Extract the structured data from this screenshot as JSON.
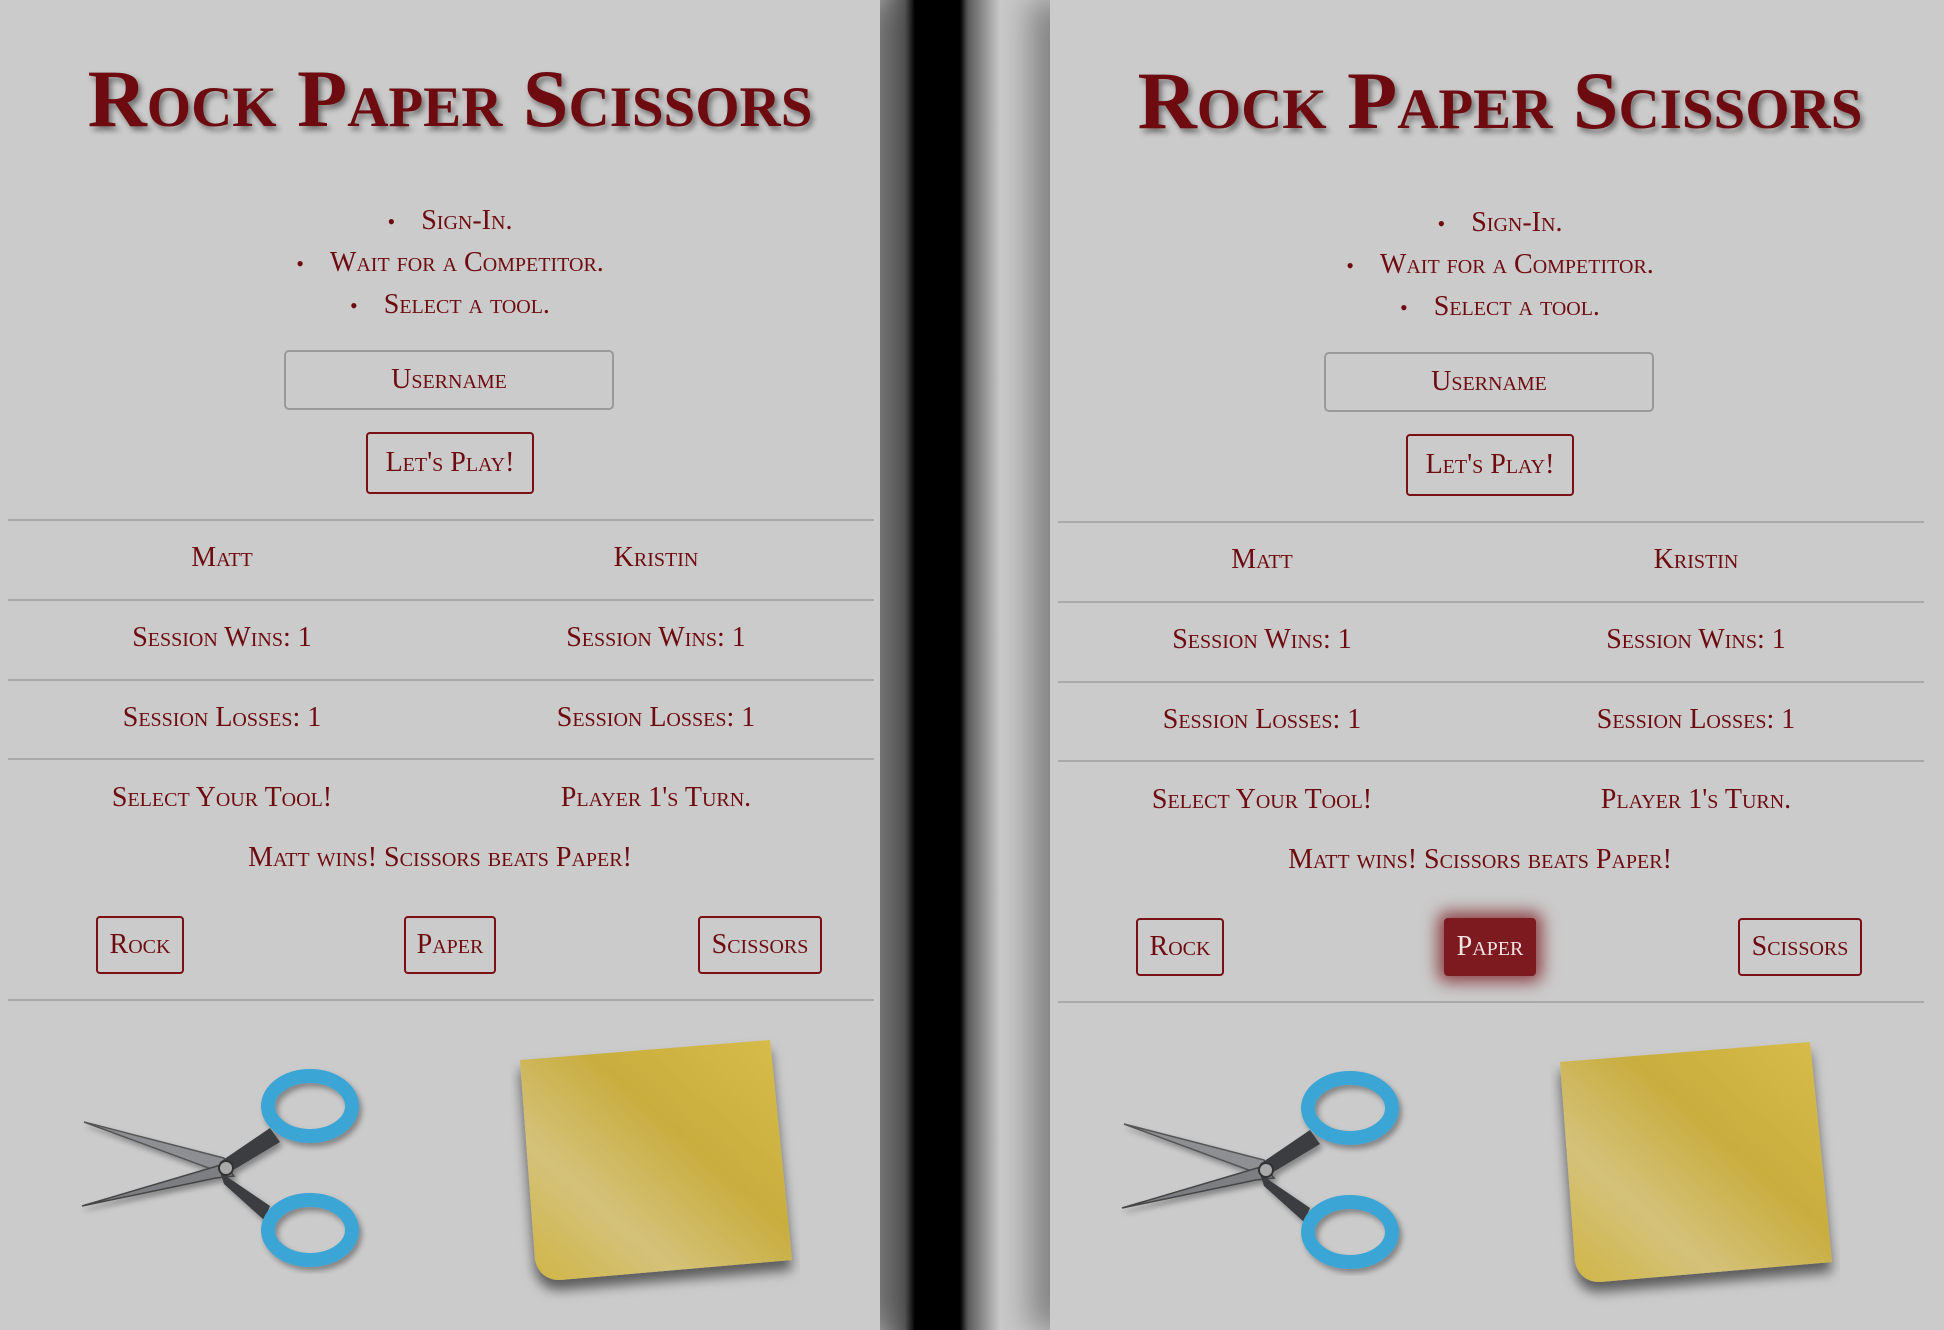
{
  "title": "Rock Paper Scissors",
  "instructions": [
    "Sign-In.",
    "Wait for a Competitor.",
    "Select a tool."
  ],
  "username_placeholder": "Username",
  "play_button": "Let's Play!",
  "players": [
    {
      "name": "Matt",
      "wins": "Session Wins: 1",
      "losses": "Session Losses: 1",
      "status": "Select Your Tool!"
    },
    {
      "name": "Kristin",
      "wins": "Session Wins: 1",
      "losses": "Session Losses: 1",
      "status": "Player 1's Turn."
    }
  ],
  "result": "Matt wins! Scissors beats Paper!",
  "tools": [
    "Rock",
    "Paper",
    "Scissors"
  ],
  "right_panel_selected_tool": "Paper",
  "images": {
    "player1_choice": "scissors-icon",
    "player2_choice": "sticky-note-paper-icon"
  },
  "colors": {
    "accent": "#6e0b10",
    "selected_button": "#7d1a20",
    "background": "#cbcbcb"
  }
}
